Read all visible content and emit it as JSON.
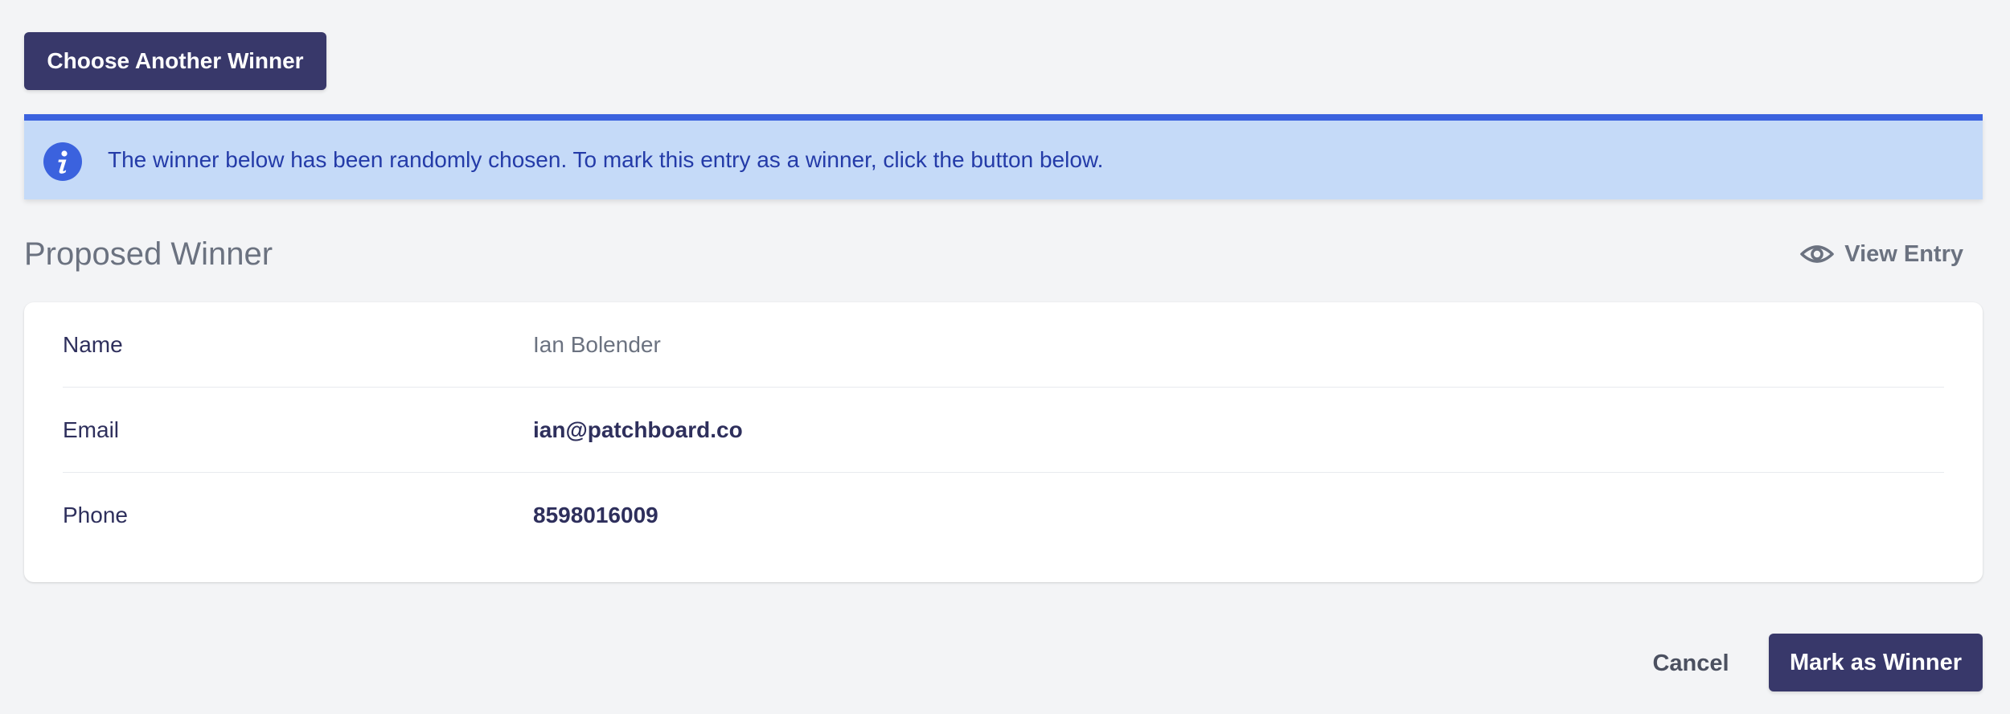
{
  "top_actions": {
    "choose_another_label": "Choose Another Winner"
  },
  "alert": {
    "icon": "info-icon",
    "message": "The winner below has been randomly chosen. To mark this entry as a winner, click the button below."
  },
  "section": {
    "title": "Proposed Winner",
    "view_entry_label": "View Entry",
    "view_entry_icon": "eye-icon"
  },
  "details": [
    {
      "label": "Name",
      "value": "Ian Bolender"
    },
    {
      "label": "Email",
      "value": "ian@patchboard.co"
    },
    {
      "label": "Phone",
      "value": "8598016009"
    }
  ],
  "footer": {
    "cancel_label": "Cancel",
    "mark_winner_label": "Mark as Winner"
  },
  "colors": {
    "primary_button": "#38386a",
    "alert_background": "#c5daf8",
    "alert_accent": "#3b62de",
    "page_background": "#f3f4f6"
  }
}
